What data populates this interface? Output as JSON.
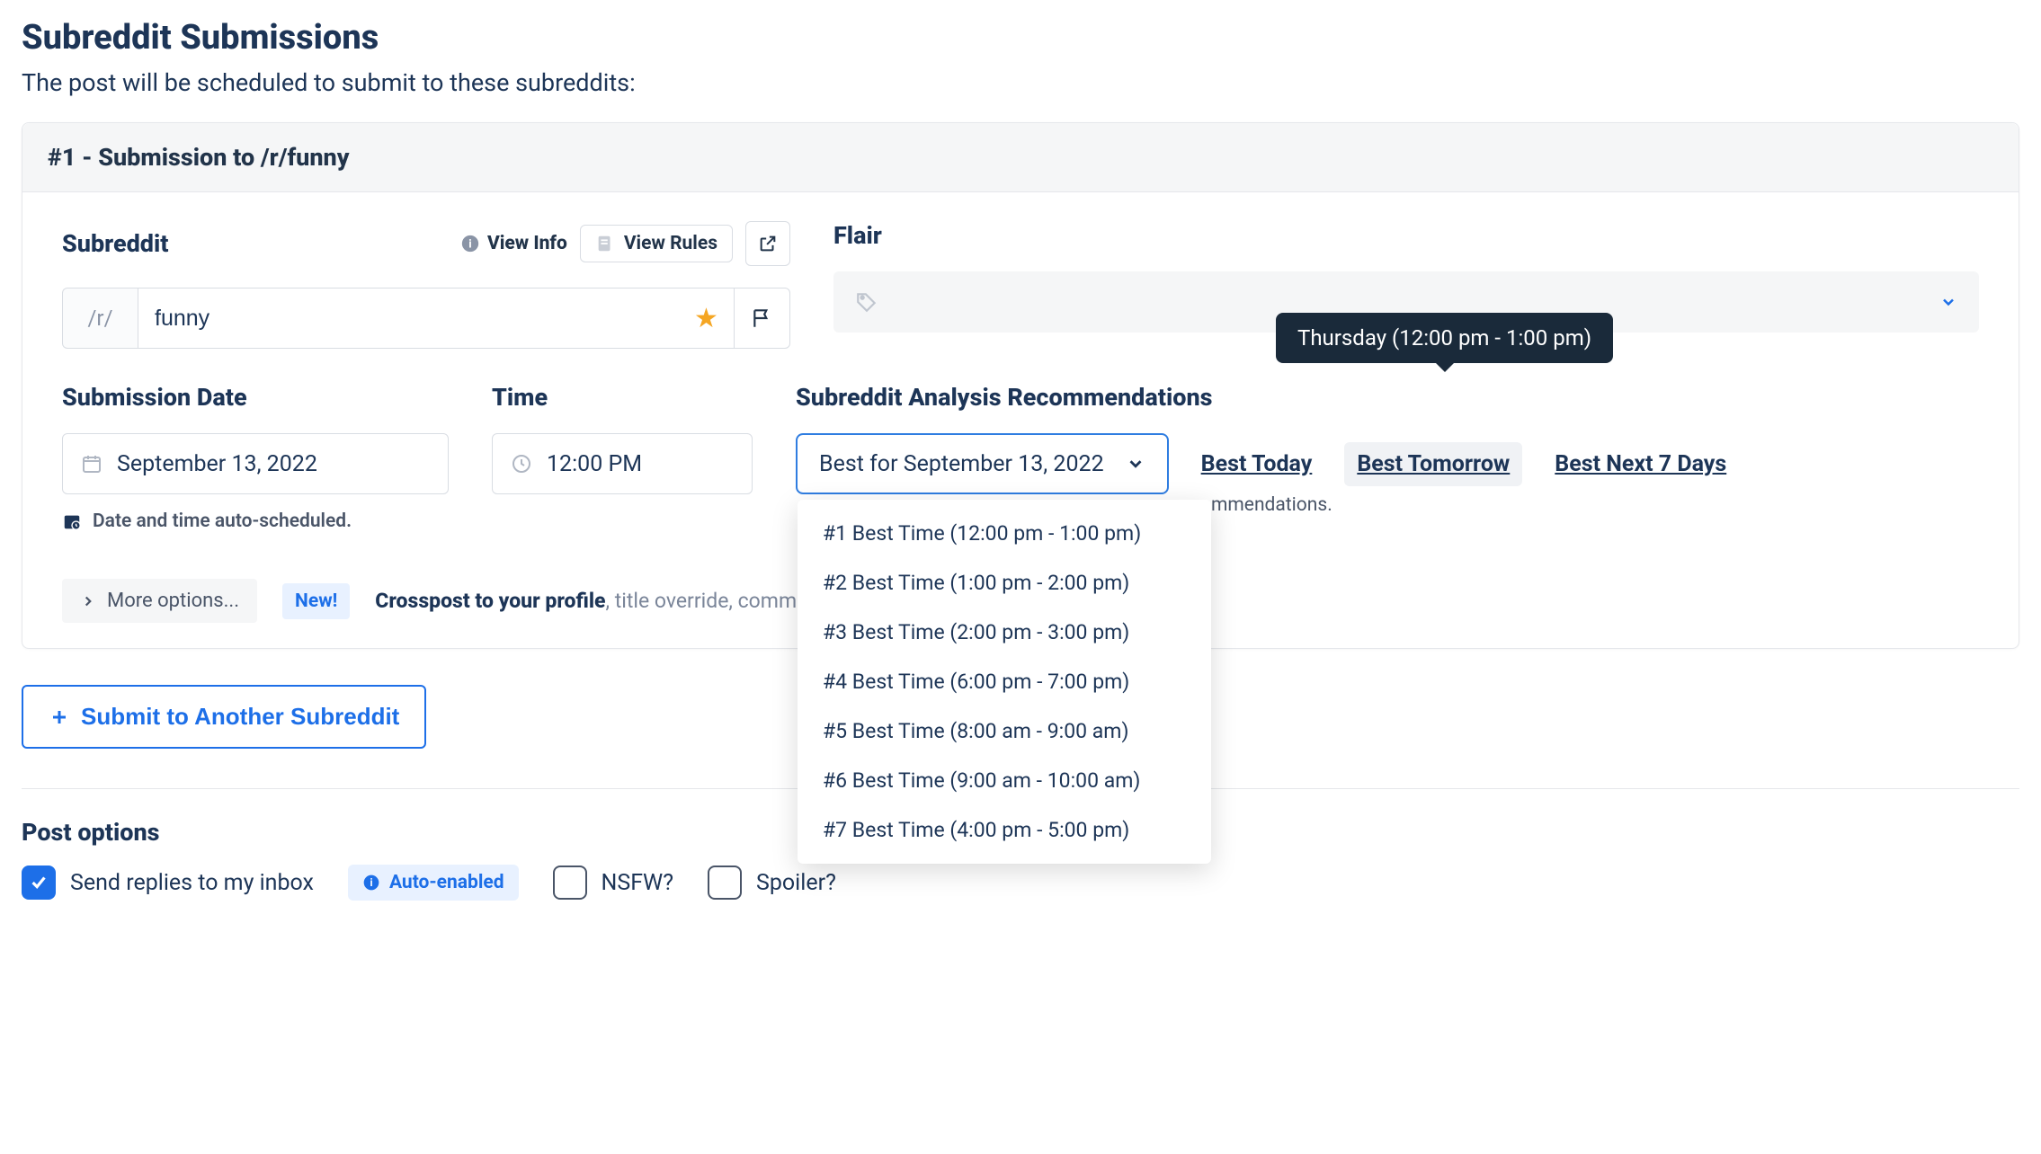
{
  "page": {
    "title": "Subreddit Submissions",
    "subtitle": "The post will be scheduled to submit to these subreddits:"
  },
  "submission": {
    "header": "#1 - Submission to /r/funny",
    "subreddit_label": "Subreddit",
    "view_info": "View Info",
    "view_rules": "View Rules",
    "prefix": "/r/",
    "subreddit_value": "funny",
    "flair_label": "Flair",
    "date_label": "Submission Date",
    "date_value": "September 13, 2022",
    "time_label": "Time",
    "time_value": "12:00 PM",
    "auto_note": "Date and time auto-scheduled.",
    "reco_label": "Subreddit Analysis Recommendations",
    "reco_selected": "Best for September 13, 2022",
    "reco_links": {
      "today": "Best Today",
      "tomorrow": "Best Tomorrow",
      "week": "Best Next 7 Days"
    },
    "reco_note_suffix": "ommendations.",
    "tooltip": "Thursday (12:00 pm - 1:00 pm)",
    "dropdown": [
      "#1 Best Time (12:00 pm - 1:00 pm)",
      "#2 Best Time (1:00 pm - 2:00 pm)",
      "#3 Best Time (2:00 pm - 3:00 pm)",
      "#4 Best Time (6:00 pm - 7:00 pm)",
      "#5 Best Time (8:00 am - 9:00 am)",
      "#6 Best Time (9:00 am - 10:00 am)",
      "#7 Best Time (4:00 pm - 5:00 pm)"
    ],
    "more_options": "More options...",
    "new_badge": "New!",
    "crosspost_bold": "Crosspost to your profile",
    "crosspost_rest": ", title override, comment c"
  },
  "submit_another": "Submit to Another Subreddit",
  "post_options": {
    "title": "Post options",
    "send_replies": "Send replies to my inbox",
    "auto_enabled": "Auto-enabled",
    "nsfw": "NSFW?",
    "spoiler": "Spoiler?"
  }
}
